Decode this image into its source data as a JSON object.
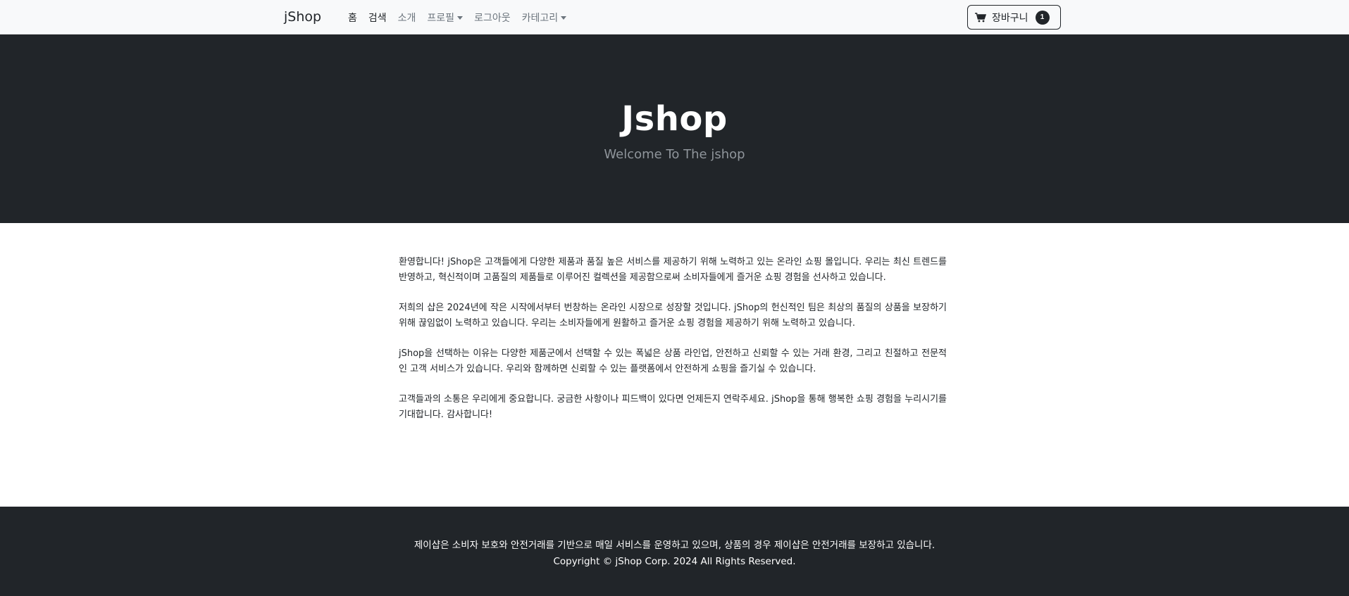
{
  "navbar": {
    "brand": "jShop",
    "links": [
      {
        "label": "홈",
        "active": true
      },
      {
        "label": "검색",
        "active": true
      },
      {
        "label": "소개",
        "active": false
      },
      {
        "label": "프로필",
        "active": false,
        "dropdown": true
      },
      {
        "label": "로그아웃",
        "active": false
      },
      {
        "label": "카테고리",
        "active": false,
        "dropdown": true
      }
    ],
    "cart": {
      "label": "장바구니",
      "count": "1",
      "icon": "cart-icon"
    }
  },
  "hero": {
    "title": "Jshop",
    "subtitle": "Welcome To The jshop"
  },
  "main": {
    "paragraphs": [
      "환영합니다! jShop은 고객들에게 다양한 제품과 품질 높은 서비스를 제공하기 위해 노력하고 있는 온라인 쇼핑 몰입니다. 우리는 최신 트렌드를 반영하고, 혁신적이며 고품질의 제품들로 이루어진 컬렉션을 제공함으로써 소비자들에게 즐거운 쇼핑 경험을 선사하고 있습니다.",
      "저희의 샵은 2024년에 작은 시작에서부터 번창하는 온라인 시장으로 성장할 것입니다. jShop의 헌신적인 팀은 최상의 품질의 상품을 보장하기 위해 끊임없이 노력하고 있습니다. 우리는 소비자들에게 원활하고 즐거운 쇼핑 경험을 제공하기 위해 노력하고 있습니다.",
      "jShop을 선택하는 이유는 다양한 제품군에서 선택할 수 있는 폭넓은 상품 라인업, 안전하고 신뢰할 수 있는 거래 환경, 그리고 친절하고 전문적인 고객 서비스가 있습니다. 우리와 함께하면 신뢰할 수 있는 플랫폼에서 안전하게 쇼핑을 즐기실 수 있습니다.",
      "고객들과의 소통은 우리에게 중요합니다. 궁금한 사항이나 피드백이 있다면 언제든지 연락주세요. jShop을 통해 행복한 쇼핑 경험을 누리시기를 기대합니다. 감사합니다!"
    ]
  },
  "footer": {
    "line1": "제이샵은 소비자 보호와 안전거래를 기반으로 매일 서비스를 운영하고 있으며, 상품의 경우 제이샵은 안전거래를 보장하고 있습니다.",
    "line2": "Copyright © jShop Corp. 2024 All Rights Reserved."
  }
}
